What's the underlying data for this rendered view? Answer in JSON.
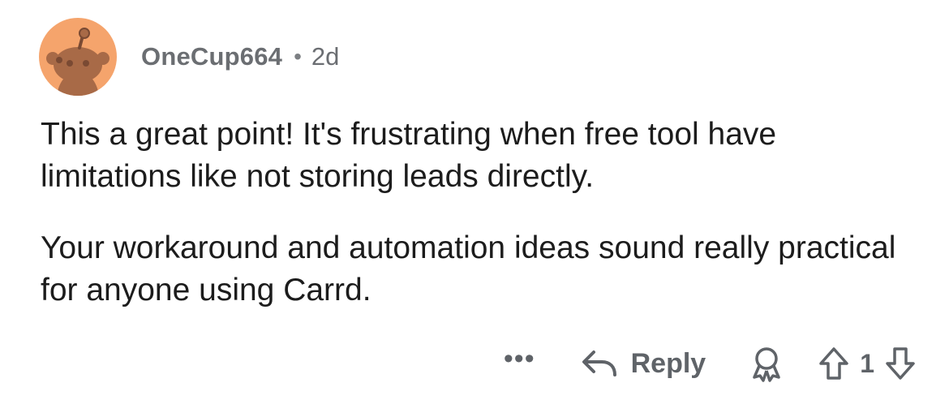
{
  "comment": {
    "author": "OneCup664",
    "separator": "•",
    "age": "2d",
    "paragraphs": [
      "This a great point! It's frustrating when free tool have limitations like not storing leads directly.",
      "Your workaround and automation ideas sound really practical for anyone using Carrd."
    ],
    "actions": {
      "more_label": "•••",
      "reply_label": "Reply",
      "score": "1"
    },
    "icons": {
      "avatar": "snoo-avatar-icon",
      "more": "more-options-icon",
      "reply": "reply-arrow-icon",
      "award": "award-icon",
      "upvote": "upvote-arrow-icon",
      "downvote": "downvote-arrow-icon"
    },
    "colors": {
      "avatar_bg": "#f5a46c",
      "meta_text": "#6b6e72",
      "body_text": "#1c1c1c",
      "action_text": "#5f6368"
    }
  }
}
